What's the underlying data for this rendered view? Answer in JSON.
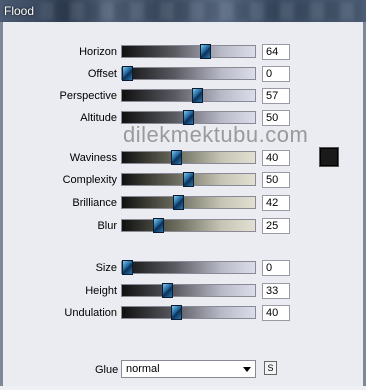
{
  "window": {
    "title": "Flood"
  },
  "watermark": "dilekmektubu.com",
  "controls": [
    {
      "label": "Horizon",
      "value": "64",
      "level": 0.64,
      "gradient": "cool"
    },
    {
      "label": "Offset",
      "value": "0",
      "level": 0.0,
      "gradient": "cool"
    },
    {
      "label": "Perspective",
      "value": "57",
      "level": 0.57,
      "gradient": "cool"
    },
    {
      "label": "Altitude",
      "value": "50",
      "level": 0.5,
      "gradient": "cool"
    },
    {
      "label": "Waviness",
      "value": "40",
      "level": 0.4,
      "gradient": "warm"
    },
    {
      "label": "Complexity",
      "value": "50",
      "level": 0.5,
      "gradient": "warm"
    },
    {
      "label": "Brilliance",
      "value": "42",
      "level": 0.42,
      "gradient": "warm"
    },
    {
      "label": "Blur",
      "value": "25",
      "level": 0.25,
      "gradient": "warm"
    },
    {
      "label": "Size",
      "value": "0",
      "level": 0.0,
      "gradient": "cool"
    },
    {
      "label": "Height",
      "value": "33",
      "level": 0.33,
      "gradient": "cool"
    },
    {
      "label": "Undulation",
      "value": "40",
      "level": 0.4,
      "gradient": "cool"
    }
  ],
  "glue": {
    "label": "Glue",
    "selected": "normal",
    "sync_label": "S"
  },
  "color_swatch": {
    "color": "#1a1a1a"
  }
}
